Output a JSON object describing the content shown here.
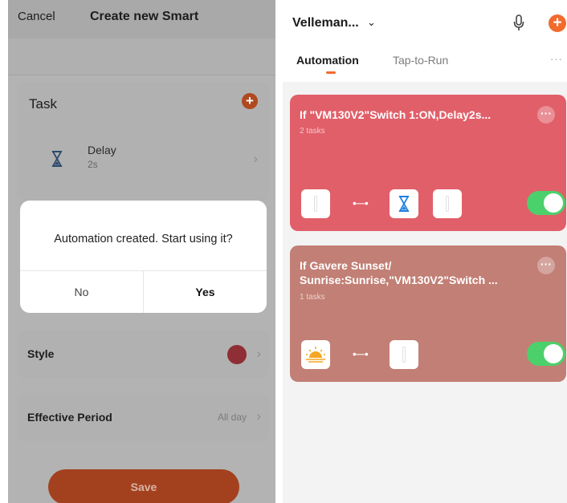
{
  "left": {
    "header": {
      "cancel": "Cancel",
      "title": "Create new Smart"
    },
    "task": {
      "title": "Task",
      "item_label": "Delay",
      "item_value": "2s"
    },
    "dialog": {
      "message": "Automation created. Start using it?",
      "no": "No",
      "yes": "Yes"
    },
    "style": {
      "label": "Style",
      "color": "#8f2e35"
    },
    "period": {
      "label": "Effective Period",
      "value": "All day"
    },
    "save": "Save"
  },
  "right": {
    "header": {
      "home_name": "Velleman...",
      "chevron": "⌄"
    },
    "tabs": {
      "automation": "Automation",
      "tap_to_run": "Tap-to-Run",
      "more": "···"
    },
    "automations": [
      {
        "title": "If \"VM130V2\"Switch 1:ON,Delay2s...",
        "tasks": "2 tasks",
        "color": "#e15f69",
        "enabled": true
      },
      {
        "title": "If Gavere Sunset/ Sunrise:Sunrise,\"VM130V2\"Switch ...",
        "tasks": "1 tasks",
        "color": "#c27f75",
        "enabled": true
      }
    ]
  },
  "icons": {
    "hourglass": "hourglass-icon",
    "add": "plus-icon",
    "mic": "microphone-icon",
    "sunrise": "sunrise-icon",
    "chevron": "chevron-right-icon"
  }
}
